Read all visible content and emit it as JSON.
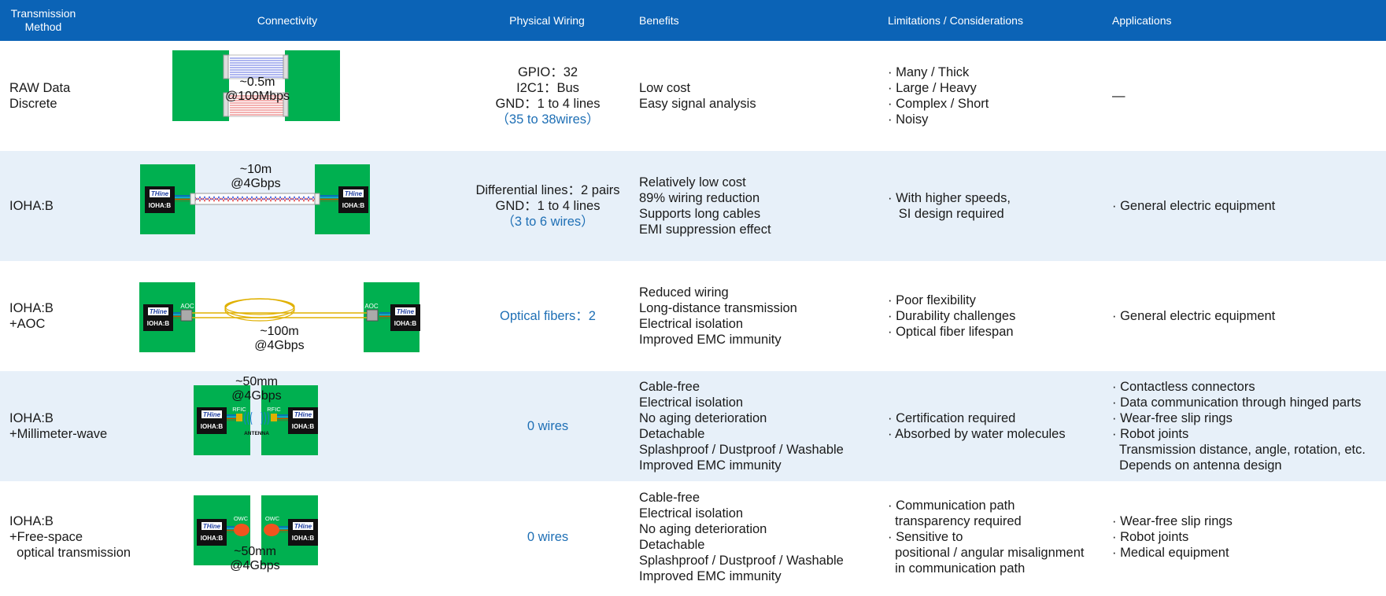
{
  "headers": [
    "Transmission\nMethod",
    "Connectivity",
    "Physical Wiring",
    "Benefits",
    "Limitations / Considerations",
    "Applications"
  ],
  "chip": {
    "logo": "THine",
    "label": "IOHA:B"
  },
  "colors": {
    "header": "#0b63b6",
    "alt_row": "#e7f0f9",
    "board": "#00b050",
    "link_text": "#1e6fb5"
  },
  "rows": [
    {
      "method": [
        "RAW Data",
        "Discrete"
      ],
      "diagram": {
        "dist": "~0.5m",
        "speed": "@100Mbps"
      },
      "wiring": [
        "GPIO：32",
        "I2C1：Bus",
        "GND：1 to 4 lines"
      ],
      "wiring_note": "（35 to 38wires）",
      "benefits": [
        "Low cost",
        "Easy signal analysis"
      ],
      "limitations": [
        "· Many / Thick",
        "· Large / Heavy",
        "· Complex / Short",
        "· Noisy"
      ],
      "applications": [
        "—"
      ]
    },
    {
      "method": [
        "IOHA:B"
      ],
      "diagram": {
        "dist": "~10m",
        "speed": "@4Gbps"
      },
      "wiring": [
        "Differential lines：2 pairs",
        "GND：1 to 4 lines"
      ],
      "wiring_note": "（3 to 6 wires）",
      "benefits": [
        "Relatively low cost",
        "89% wiring reduction",
        "Supports long cables",
        "EMI suppression effect"
      ],
      "limitations": [
        "· With higher speeds,",
        "   SI design required"
      ],
      "applications": [
        "· General electric equipment"
      ]
    },
    {
      "method": [
        "IOHA:B",
        "+AOC"
      ],
      "diagram": {
        "dist": "~100m",
        "speed": "@4Gbps",
        "tag": "AOC"
      },
      "wiring": [],
      "wiring_note": "Optical fibers：2",
      "benefits": [
        "Reduced wiring",
        "Long-distance transmission",
        "Electrical isolation",
        "Improved EMC immunity"
      ],
      "limitations": [
        "· Poor flexibility",
        "· Durability challenges",
        "· Optical fiber lifespan"
      ],
      "applications": [
        "· General electric equipment"
      ]
    },
    {
      "method": [
        "IOHA:B",
        "+Millimeter-wave"
      ],
      "diagram": {
        "dist": "~50mm",
        "speed": "@4Gbps",
        "tag": "RFIC",
        "antenna": "ANTENNA"
      },
      "wiring": [],
      "wiring_note": "0 wires",
      "benefits": [
        "Cable-free",
        "Electrical isolation",
        "No aging deterioration",
        "Detachable",
        "Splashproof / Dustproof / Washable",
        "Improved EMC immunity"
      ],
      "limitations": [
        "· Certification required",
        "· Absorbed by water molecules"
      ],
      "applications": [
        "· Contactless connectors",
        "· Data communication through hinged parts",
        "· Wear-free slip rings",
        "· Robot joints",
        "  Transmission distance, angle, rotation, etc.",
        "  Depends on antenna design"
      ]
    },
    {
      "method": [
        "IOHA:B",
        "+Free-space",
        "  optical transmission"
      ],
      "diagram": {
        "dist": "~50mm",
        "speed": "@4Gbps",
        "tag": "OWC"
      },
      "wiring": [],
      "wiring_note": "0 wires",
      "benefits": [
        "Cable-free",
        "Electrical isolation",
        "No aging deterioration",
        "Detachable",
        "Splashproof / Dustproof / Washable",
        "Improved EMC immunity"
      ],
      "limitations": [
        "· Communication path",
        "  transparency required",
        "· Sensitive to",
        "  positional / angular misalignment",
        "  in communication path"
      ],
      "applications": [
        "· Wear-free slip rings",
        "· Robot joints",
        "· Medical equipment"
      ]
    }
  ]
}
